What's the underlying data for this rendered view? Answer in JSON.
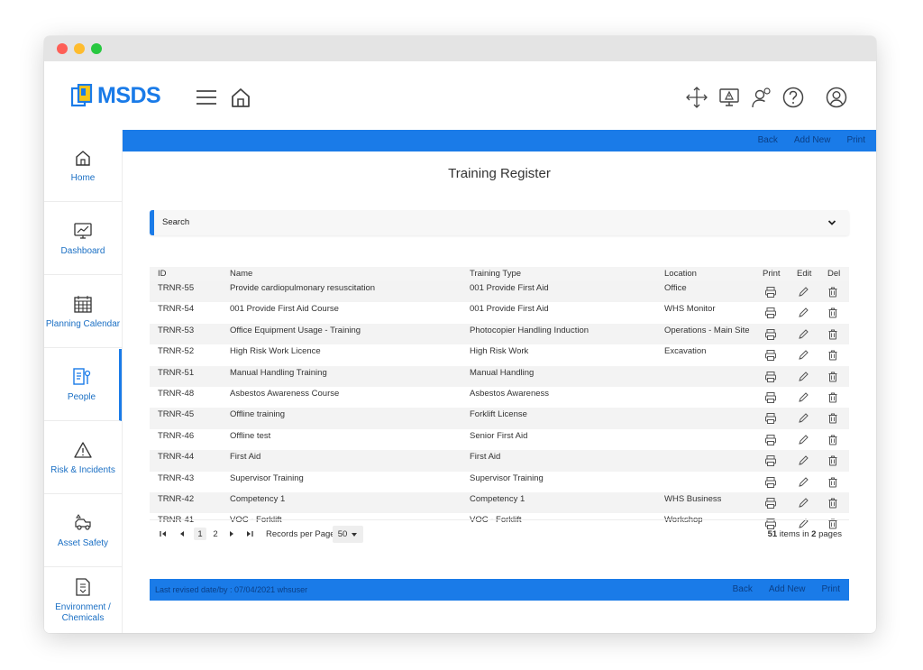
{
  "app": {
    "logo_text": "MSDS"
  },
  "sidebar": {
    "items": [
      {
        "label": "Home"
      },
      {
        "label": "Dashboard"
      },
      {
        "label": "Planning Calendar"
      },
      {
        "label": "People"
      },
      {
        "label": "Risk & Incidents"
      },
      {
        "label": "Asset Safety"
      },
      {
        "label": "Environment / Chemicals"
      }
    ]
  },
  "topbar": {
    "back": "Back",
    "add_new": "Add New",
    "print": "Print"
  },
  "page": {
    "title": "Training Register"
  },
  "search": {
    "label": "Search"
  },
  "table": {
    "headers": {
      "id": "ID",
      "name": "Name",
      "type": "Training Type",
      "location": "Location",
      "print": "Print",
      "edit": "Edit",
      "del": "Del"
    },
    "rows": [
      {
        "id": "TRNR-55",
        "name": "Provide cardiopulmonary resuscitation",
        "type": "001 Provide First Aid",
        "location": "Office"
      },
      {
        "id": "TRNR-54",
        "name": "001 Provide First Aid Course",
        "type": "001 Provide First Aid",
        "location": "WHS Monitor"
      },
      {
        "id": "TRNR-53",
        "name": "Office Equipment Usage - Training",
        "type": "Photocopier Handling Induction",
        "location": "Operations - Main Site"
      },
      {
        "id": "TRNR-52",
        "name": "High Risk Work Licence",
        "type": "High Risk Work",
        "location": "Excavation"
      },
      {
        "id": "TRNR-51",
        "name": "Manual Handling Training",
        "type": "Manual Handling",
        "location": ""
      },
      {
        "id": "TRNR-48",
        "name": "Asbestos Awareness Course",
        "type": "Asbestos Awareness",
        "location": ""
      },
      {
        "id": "TRNR-45",
        "name": "Offline training",
        "type": "Forklift License",
        "location": ""
      },
      {
        "id": "TRNR-46",
        "name": "Offline test",
        "type": "Senior First Aid",
        "location": ""
      },
      {
        "id": "TRNR-44",
        "name": "First Aid",
        "type": "First Aid",
        "location": ""
      },
      {
        "id": "TRNR-43",
        "name": "Supervisor Training",
        "type": "Supervisor Training",
        "location": ""
      },
      {
        "id": "TRNR-42",
        "name": "Competency 1",
        "type": "Competency 1",
        "location": "WHS Business"
      },
      {
        "id": "TRNR-41",
        "name": "VOC - Forklift",
        "type": "VOC - Forklift",
        "location": "Workshop"
      }
    ]
  },
  "pager": {
    "page1": "1",
    "page2": "2",
    "records_label": "Records per Page",
    "records_value": "50",
    "items_count": "51",
    "items_mid": "items in",
    "pages_count": "2",
    "pages_label": "pages"
  },
  "footer": {
    "revised": "Last revised date/by : 07/04/2021 whsuser",
    "back": "Back",
    "add_new": "Add New",
    "print": "Print"
  },
  "colors": {
    "accent": "#1a7be8",
    "bar_text": "#0b3f86",
    "sidebar_label": "#1a6fc4"
  }
}
